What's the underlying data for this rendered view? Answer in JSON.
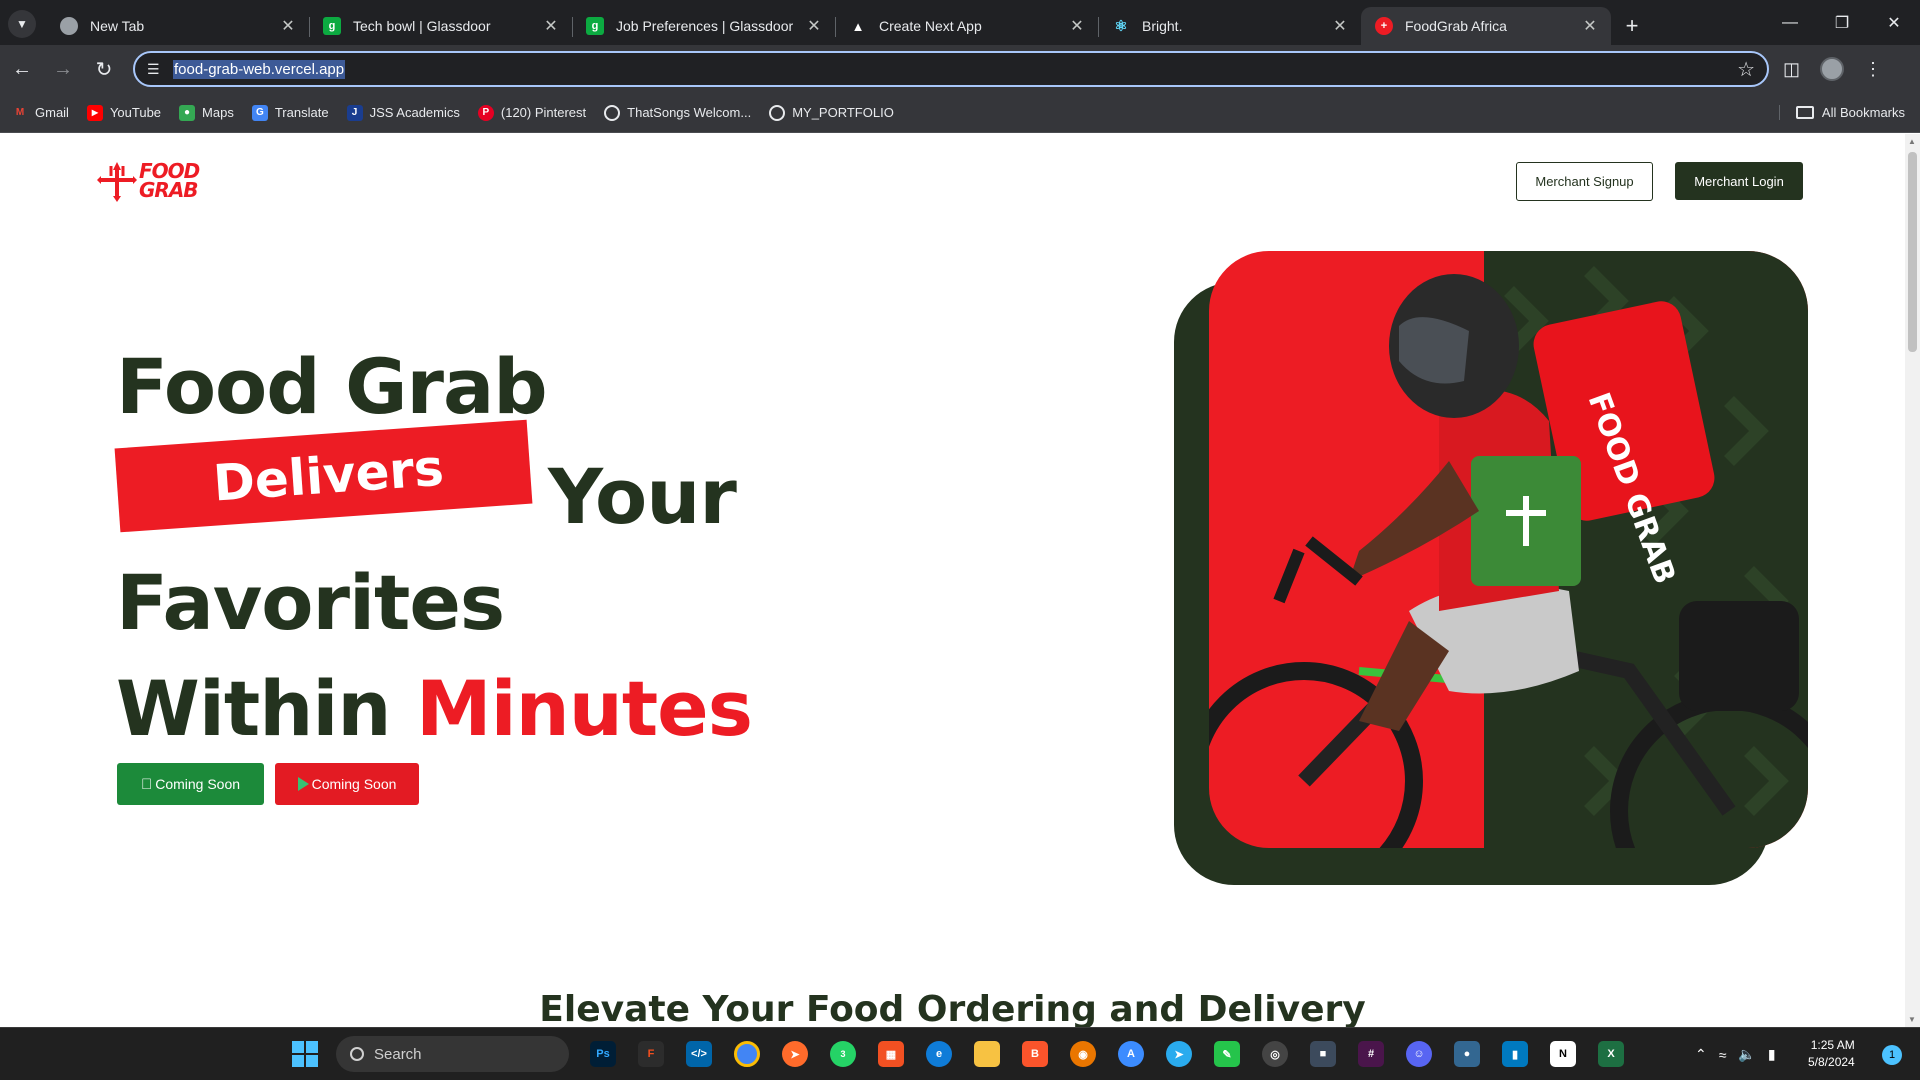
{
  "browser": {
    "tabs": [
      {
        "title": "New Tab",
        "favicon": "chrome-icon"
      },
      {
        "title": "Tech bowl | Glassdoor",
        "favicon": "glassdoor-icon"
      },
      {
        "title": "Job Preferences | Glassdoor",
        "favicon": "glassdoor-icon"
      },
      {
        "title": "Create Next App",
        "favicon": "vercel-icon"
      },
      {
        "title": "Bright.",
        "favicon": "react-icon"
      },
      {
        "title": "FoodGrab Africa",
        "favicon": "foodgrab-icon",
        "active": true
      }
    ],
    "url": "food-grab-web.vercel.app",
    "bookmarks": [
      {
        "label": "Gmail",
        "icon": "gmail-icon"
      },
      {
        "label": "YouTube",
        "icon": "youtube-icon"
      },
      {
        "label": "Maps",
        "icon": "maps-icon"
      },
      {
        "label": "Translate",
        "icon": "translate-icon"
      },
      {
        "label": "JSS Academics",
        "icon": "jss-icon"
      },
      {
        "label": "(120) Pinterest",
        "icon": "pinterest-icon"
      },
      {
        "label": "ThatSongs Welcom...",
        "icon": "globe-icon"
      },
      {
        "label": "MY_PORTFOLIO",
        "icon": "globe-icon"
      }
    ],
    "all_bookmarks_label": "All Bookmarks"
  },
  "page": {
    "logo_text": "FOOD GRAB",
    "logo_line1": "FOOD",
    "logo_line2": "GRAB",
    "merchant_signup": "Merchant Signup",
    "merchant_login": "Merchant Login",
    "hero": {
      "line1": "Food Grab",
      "ribbon": "Delivers",
      "line2_rest": "Your",
      "line3": "Favorites",
      "line4_prefix": "Within",
      "line4_highlight": "Minutes"
    },
    "app_store_button": "Coming Soon",
    "play_store_button": "Coming Soon",
    "section_title": "Elevate Your Food Ordering and Delivery",
    "colors": {
      "brand_red": "#ed1c24",
      "brand_green": "#24331f",
      "apple_green": "#1c8a3a"
    }
  },
  "taskbar": {
    "search_placeholder": "Search",
    "time": "1:25 AM",
    "date": "5/8/2024",
    "notification_count": "1",
    "whatsapp_badge": "3"
  }
}
